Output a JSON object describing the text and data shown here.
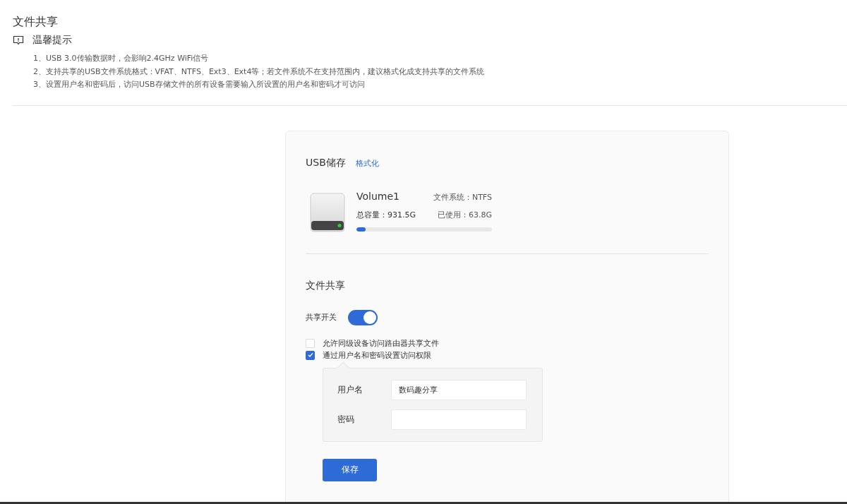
{
  "page_title": "文件共享",
  "tip": {
    "title": "温馨提示",
    "items": [
      "1、USB 3.0传输数据时，会影响2.4GHz WiFi信号",
      "2、支持共享的USB文件系统格式：VFAT、NTFS、Ext3、Ext4等；若文件系统不在支持范围内，建议格式化成支持共享的文件系统",
      "3、设置用户名和密码后，访问USB存储文件的所有设备需要输入所设置的用户名和密码才可访问"
    ]
  },
  "usb": {
    "title": "USB储存",
    "format_link": "格式化",
    "volume": "Volume1",
    "filesystem": "文件系统：NTFS",
    "capacity": "总容量：931.5G",
    "used": "已使用：63.8G",
    "level": 0.07
  },
  "sharing": {
    "title": "文件共享",
    "switch_label": "共享开关",
    "on": true,
    "options": [
      {
        "label": "允许同级设备访问路由器共享文件",
        "checked": false
      },
      {
        "label": "通过用户名和密码设置访问权限",
        "checked": true
      }
    ],
    "fields": [
      {
        "label": "用户名",
        "value": "数码趣分享"
      },
      {
        "label": "密码"
      }
    ],
    "save": "保存"
  }
}
